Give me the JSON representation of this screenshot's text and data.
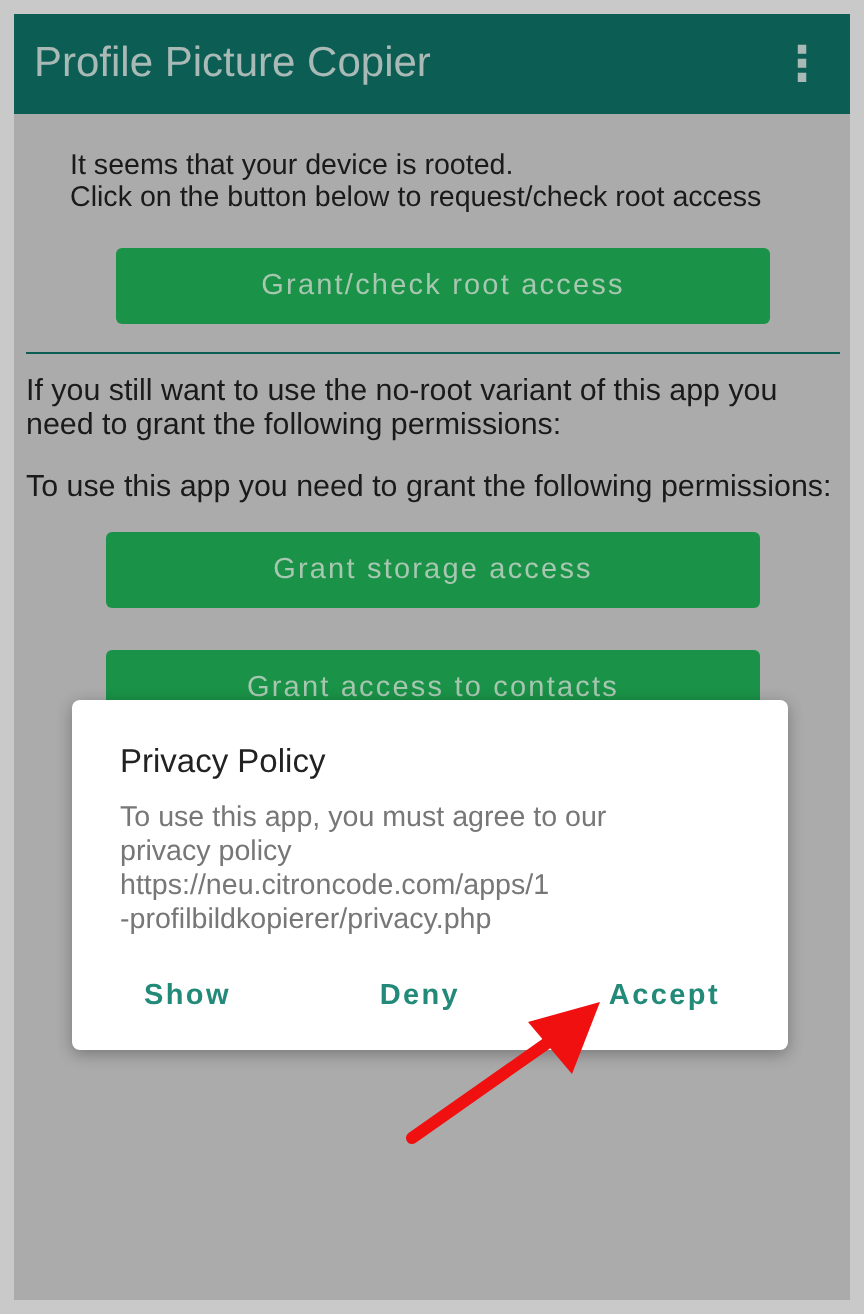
{
  "app_bar": {
    "title": "Profile Picture Copier",
    "menu_icon": "⋮"
  },
  "root_section": {
    "text": "It seems that your device is rooted.\nClick on the button below to request/check root access",
    "button": "Grant/check root access"
  },
  "no_root_section": {
    "text": "If you still want to use the no-root variant of this app you need to grant the following permissions:",
    "permissions_text": "To use this app you need to grant the following permissions:",
    "buttons": [
      "Grant storage access",
      "Grant access to contacts"
    ]
  },
  "dialog": {
    "title": "Privacy Policy",
    "message": "To use this app, you must agree to our\nprivacy policy\nhttps://neu.citroncode.com/apps/1\n-profilbildkopierer/privacy.php",
    "actions": [
      "Show",
      "Deny",
      "Accept"
    ]
  }
}
